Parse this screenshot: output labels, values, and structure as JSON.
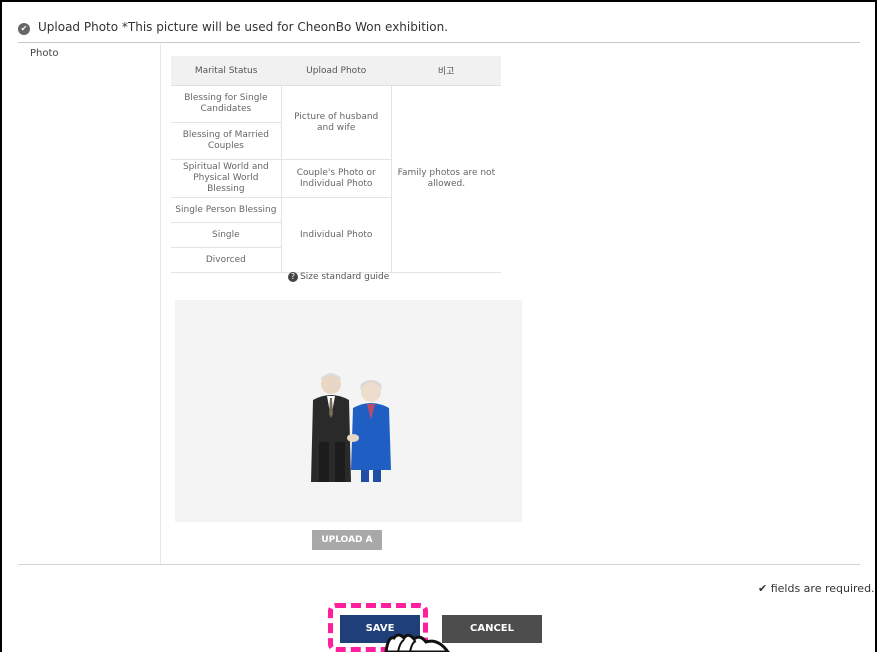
{
  "header": {
    "check_icon": "check-circle-icon",
    "title": "Upload Photo *This picture will be used for CheonBo Won exhibition."
  },
  "form": {
    "photo_label": "Photo"
  },
  "guide_table": {
    "headers": [
      "Marital Status",
      "Upload Photo",
      "비고"
    ],
    "status": [
      "Blessing for Single Candidates",
      "Blessing of Married Couples",
      "Spiritual World and Physical World Blessing",
      "Single Person Blessing",
      "Single",
      "Divorced"
    ],
    "upload": [
      "Picture of husband and wife",
      "Couple's Photo or Individual Photo",
      "Individual Photo"
    ],
    "note": "Family photos are not allowed."
  },
  "size_guide": {
    "icon": "question-circle-icon",
    "label": "Size standard guide"
  },
  "buttons": {
    "upload": "UPLOAD A",
    "save": "SAVE",
    "cancel": "CANCEL"
  },
  "required_note": "fields are required.",
  "colors": {
    "save_bg": "#1f3f7a",
    "cancel_bg": "#4d4d4d",
    "highlight": "#ff1f9e"
  }
}
